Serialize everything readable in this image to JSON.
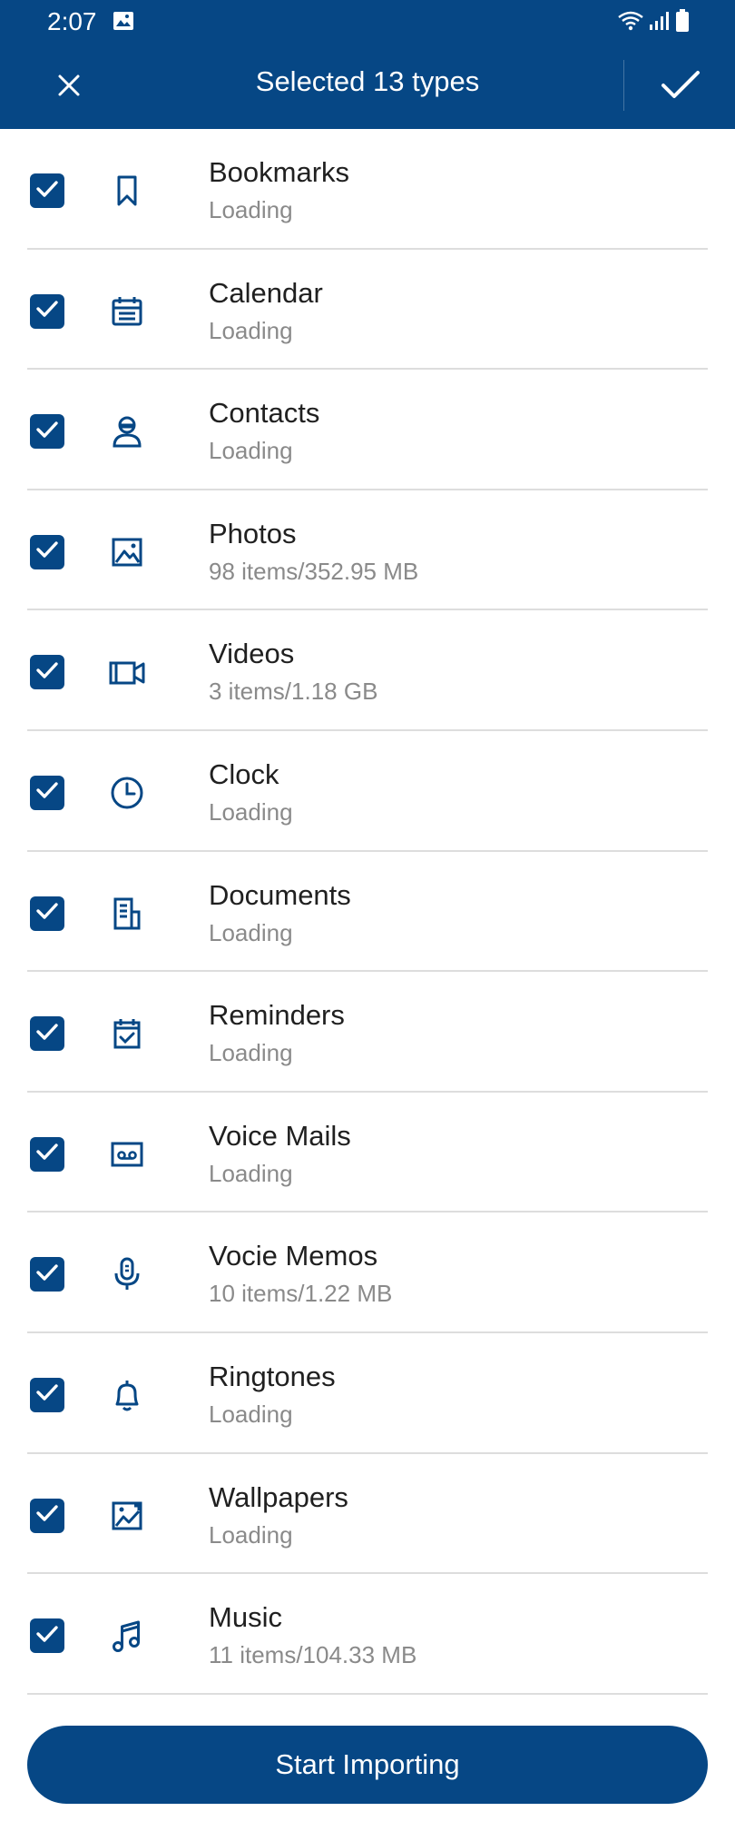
{
  "status_bar": {
    "time": "2:07"
  },
  "toolbar": {
    "title": "Selected 13 types"
  },
  "items": [
    {
      "name": "Bookmarks",
      "detail": "Loading",
      "icon": "bookmark-icon"
    },
    {
      "name": "Calendar",
      "detail": "Loading",
      "icon": "calendar-icon"
    },
    {
      "name": "Contacts",
      "detail": "Loading",
      "icon": "contact-icon"
    },
    {
      "name": "Photos",
      "detail": "98 items/352.95 MB",
      "icon": "photo-icon"
    },
    {
      "name": "Videos",
      "detail": "3 items/1.18 GB",
      "icon": "video-icon"
    },
    {
      "name": "Clock",
      "detail": "Loading",
      "icon": "clock-icon"
    },
    {
      "name": "Documents",
      "detail": "Loading",
      "icon": "document-icon"
    },
    {
      "name": "Reminders",
      "detail": "Loading",
      "icon": "reminder-icon"
    },
    {
      "name": "Voice Mails",
      "detail": "Loading",
      "icon": "voicemail-icon"
    },
    {
      "name": "Vocie Memos",
      "detail": "10 items/1.22 MB",
      "icon": "microphone-icon"
    },
    {
      "name": "Ringtones",
      "detail": "Loading",
      "icon": "bell-icon"
    },
    {
      "name": "Wallpapers",
      "detail": "Loading",
      "icon": "wallpaper-icon"
    },
    {
      "name": "Music",
      "detail": "11 items/104.33 MB",
      "icon": "music-note-icon"
    }
  ],
  "footer": {
    "button_label": "Start Importing"
  },
  "colors": {
    "primary": "#064785",
    "secondary_text": "#8a8a8a",
    "divider": "#dddddd"
  }
}
